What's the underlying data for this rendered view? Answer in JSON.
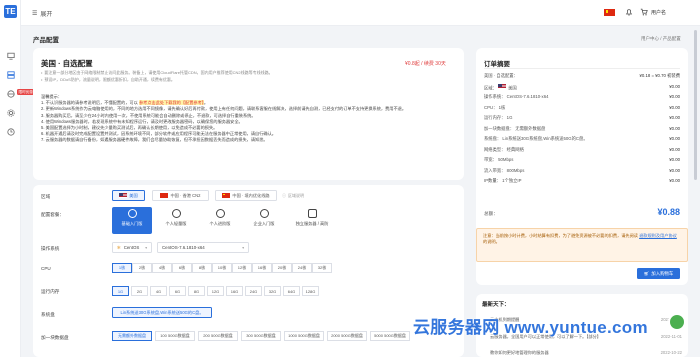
{
  "sidebar": {
    "logo": "TE",
    "badge": "限时优惠",
    "icons": [
      "monitor-icon",
      "server-icon",
      "globe-icon",
      "gear-icon",
      "clock-icon"
    ]
  },
  "header": {
    "expand_label": "展开",
    "user_name": "用户名",
    "icons": [
      "flag-cn-icon",
      "bell-icon",
      "cart-icon"
    ]
  },
  "page": {
    "title": "产品配置",
    "breadcrumb": "用户中心 / 产品配置"
  },
  "product": {
    "title": "美国 · 自选配置",
    "price": "¥0.8起 / 续费 30天",
    "subtitles": [
      "要注意一部分地区由于网络限制禁止访问此服务。装备上，请使用CloudFlare托管CDN，国内用户推荐使用CN2线路等专线线路。",
      "预设IP，DDoS防护，流量说明，限额优惠折扣，自助开通，续费有优惠。"
    ],
    "body_title": "温馨提示：",
    "body": [
      {
        "pre": "1. 不认识服务器的请参考说明后，不懂配置的，可以 ",
        "hl": "参考点击此处下载我的【配置参考】",
        "post": "。"
      },
      {
        "pre": "2. 更新Windows系统作为云电脑使用的，不同的地方选用不同镜像，请先确认好后再付款，使用上有任何问题，请联系客服在线解决，选择前请先自测，已经支付的订单不支持更换系统，费用不退。",
        "hl": "",
        "post": ""
      },
      {
        "pre": "3. 服务器购买后，请至少在24小时内使用一次，不使用系统可能会自动删除或停止，不退款，可选择自行重装系统。",
        "hl": "",
        "post": ""
      },
      {
        "pre": "4. 使用Windows服务器时，若发现系统中有未知程序运行，请及时更改服务器密码，以确保您的服务器安全。",
        "hl": "",
        "post": ""
      },
      {
        "pre": "5. 美国配置选择为小时制，建议先少量购买测试后，再确认长期使用，以免造成不必要的损失。",
        "hl": "",
        "post": ""
      },
      {
        "pre": "6. 机器开通后请及时完成配置设置并测试，因系统环境不同，部分软件或应用程序可能无法在服务器中正常使用，请自行确认。",
        "hl": "",
        "post": ""
      },
      {
        "pre": "7. 云服务器的数据请自行备份，如遇服务器硬件故障，我们会尽量协助恢复，但不承担因数据丢失而造成的损失，请知悉。",
        "hl": "",
        "post": ""
      }
    ]
  },
  "form": {
    "region_label": "区域",
    "regions": [
      {
        "name": "美国",
        "flag": "us",
        "selected": true
      },
      {
        "name": "中国 · 香港 CN2",
        "flag": "hk",
        "selected": false
      },
      {
        "name": "中国 · 境内优化线路",
        "flag": "cnf",
        "selected": false
      }
    ],
    "region_tip": "区域说明",
    "tier_label": "配置套餐：",
    "tiers": [
      {
        "name": "基础入门版",
        "selected": true
      },
      {
        "name": "个人轻量版",
        "selected": false
      },
      {
        "name": "个人进阶版",
        "selected": false
      },
      {
        "name": "企业入门版",
        "selected": false
      },
      {
        "name": "独立服务器 / 高防",
        "selected": false
      }
    ],
    "os_label": "操作系统",
    "os_family": "CentOS",
    "os_version": "CentOS-7.6.1810-x64",
    "cpu_label": "CPU",
    "cpu_options": [
      "1核",
      "2核",
      "4核",
      "6核",
      "8核",
      "10核",
      "12核",
      "16核",
      "20核",
      "24核",
      "32核"
    ],
    "cpu_selected": 0,
    "mem_label": "运行内存",
    "mem_options": [
      "1G",
      "2G",
      "4G",
      "6G",
      "8G",
      "12G",
      "16G",
      "24G",
      "32G",
      "64G",
      "128G"
    ],
    "mem_selected": 0,
    "disk_label": "系统盘",
    "disk_value": "Lin系统送30G系统盘,Win系统送50G的C盘。",
    "bw_label": "加一块数据盘",
    "bw_options": [
      "无需额外数据盘",
      "100 500G数据盘",
      "200 500G数据盘",
      "300 500G数据盘",
      "1000 500G数据盘",
      "2000 500G数据盘",
      "5000 500G数据盘"
    ],
    "bw_selected": 0
  },
  "order": {
    "title": "订单摘要",
    "lines": [
      {
        "k": "美国 · 自选配置：",
        "v": "¥0.18 = ¥0.70 初装费"
      },
      {
        "k": "区域：",
        "v": "¥0.00",
        "flag": "us",
        "kv": "美国"
      },
      {
        "k": "操作系统：",
        "v": "¥0.00",
        "kv": "CentOS-7.6.1810-x64"
      },
      {
        "k": "CPU：",
        "v": "¥0.00",
        "kv": "1核"
      },
      {
        "k": "运行内存：",
        "v": "¥0.00",
        "kv": "1G"
      },
      {
        "k": "加一块数据盘：",
        "v": "¥0.00",
        "kv": "无需额外数据盘"
      },
      {
        "k": "系统盘：",
        "v": "¥0.00",
        "kv": "Lin系统送30G系统盘,Win系统送50G的C盘。"
      },
      {
        "k": "网络类型：",
        "v": "¥0.00",
        "kv": "经典网络"
      },
      {
        "k": "带宽：",
        "v": "¥0.00",
        "kv": "50Mbps"
      },
      {
        "k": "流入带宽：",
        "v": "¥0.00",
        "kv": "800Mbps"
      },
      {
        "k": "IP数量：",
        "v": "¥0.00",
        "kv": "1个独立IP"
      }
    ],
    "due_label": "总额：",
    "due_amount": "¥0.88",
    "notice_pre": "注意：当前按小时计费，小时结算有扣费，为了避免资源被不必要的扣费，请先阅读 ",
    "notice_link": "退款规则及用户协议",
    "notice_post": " 的说明。",
    "cart_button": "加入购物车"
  },
  "news": {
    "title": "最新天下：",
    "items": [
      {
        "text": "云主机到期提醒",
        "date": "2022-11-02"
      },
      {
        "text": "云服务器，全国用户可以正常使用，可以了解一下。【部分】",
        "date": "2022-11-01"
      },
      {
        "text": "教你如何更好地管理你的服务器",
        "date": "2022-10-22"
      }
    ]
  },
  "watermark": "云服务器网 www.yuntue.com"
}
